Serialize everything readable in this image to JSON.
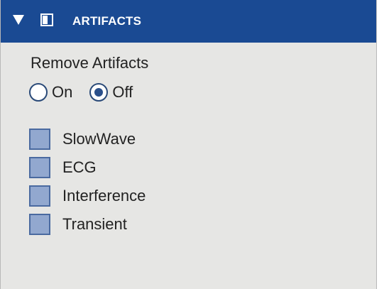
{
  "header": {
    "title": "ARTIFACTS",
    "collapse_icon": "triangle-down-icon",
    "window_icon": "window-icon"
  },
  "section": {
    "label": "Remove Artifacts"
  },
  "radio": {
    "on_label": "On",
    "off_label": "Off",
    "selected": "Off"
  },
  "checklist": {
    "items": [
      {
        "label": "SlowWave",
        "checked": false
      },
      {
        "label": "ECG",
        "checked": false
      },
      {
        "label": "Interference",
        "checked": false
      },
      {
        "label": "Transient",
        "checked": false
      }
    ]
  },
  "colors": {
    "header_bg": "#1a4a93",
    "panel_bg": "#e6e6e4",
    "checkbox_fill": "#92a8cf"
  }
}
